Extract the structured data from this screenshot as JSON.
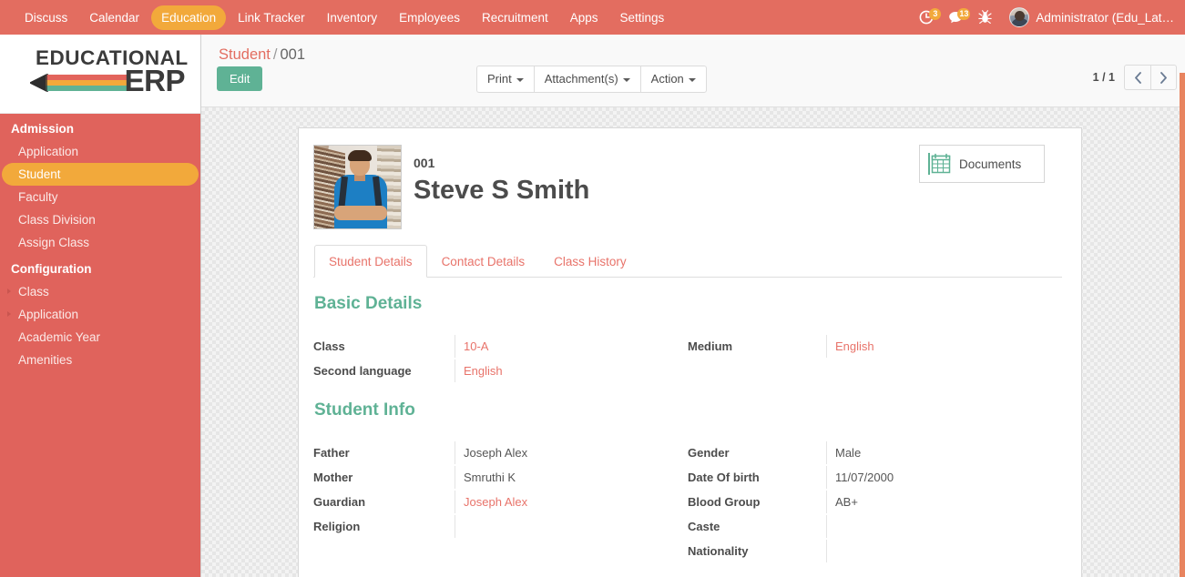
{
  "navbar": {
    "menu_items": [
      {
        "label": "Discuss",
        "active": false
      },
      {
        "label": "Calendar",
        "active": false
      },
      {
        "label": "Education",
        "active": true
      },
      {
        "label": "Link Tracker",
        "active": false
      },
      {
        "label": "Inventory",
        "active": false
      },
      {
        "label": "Employees",
        "active": false
      },
      {
        "label": "Recruitment",
        "active": false
      },
      {
        "label": "Apps",
        "active": false
      },
      {
        "label": "Settings",
        "active": false
      }
    ],
    "activity_icon": "clock-icon",
    "activity_count": "3",
    "messages_icon": "chat-bubble-icon",
    "messages_count": "13",
    "debug_icon": "bug-icon",
    "avatar_icon": "user-avatar",
    "user_label": "Administrator (Edu_Lat…",
    "bg_color": "#E36D60",
    "active_pill_color": "#F2A93B"
  },
  "sidebar": {
    "logo": {
      "line1": "EDUCATIONAL",
      "line2": "ERP",
      "pencil_colors": [
        "#E3645C",
        "#F2A93B",
        "#5FB295"
      ]
    },
    "sections": [
      {
        "title": "Admission",
        "items": [
          {
            "label": "Application",
            "active": false,
            "caret": false
          },
          {
            "label": "Student",
            "active": true,
            "caret": false
          },
          {
            "label": "Faculty",
            "active": false,
            "caret": false
          },
          {
            "label": "Class Division",
            "active": false,
            "caret": false
          },
          {
            "label": "Assign Class",
            "active": false,
            "caret": false
          }
        ]
      },
      {
        "title": "Configuration",
        "items": [
          {
            "label": "Class",
            "active": false,
            "caret": true
          },
          {
            "label": "Application",
            "active": false,
            "caret": true
          },
          {
            "label": "Academic Year",
            "active": false,
            "caret": false
          },
          {
            "label": "Amenities",
            "active": false,
            "caret": false
          }
        ]
      }
    ],
    "bg_color": "#E0635C"
  },
  "control_panel": {
    "breadcrumb_root": "Student",
    "breadcrumb_sep": "/",
    "breadcrumb_current": "001",
    "edit_label": "Edit",
    "buttons": [
      {
        "label": "Print",
        "dropdown": true
      },
      {
        "label": "Attachment(s)",
        "dropdown": true
      },
      {
        "label": "Action",
        "dropdown": true
      }
    ],
    "pager_text": "1 / 1",
    "prev_icon": "chevron-left-icon",
    "next_icon": "chevron-right-icon",
    "edit_color": "#5FB295"
  },
  "record": {
    "id": "001",
    "name": "Steve S Smith",
    "photo_alt": "student-photo",
    "stat_button": {
      "icon": "calendar-grid-icon",
      "label": "Documents"
    }
  },
  "tabs": [
    {
      "label": "Student Details",
      "active": true
    },
    {
      "label": "Contact Details",
      "active": false
    },
    {
      "label": "Class History",
      "active": false
    }
  ],
  "basic_details": {
    "title": "Basic Details",
    "left": [
      {
        "label": "Class",
        "value": "10-A",
        "is_link": true
      },
      {
        "label": "Second language",
        "value": "English",
        "is_link": true
      }
    ],
    "right": [
      {
        "label": "Medium",
        "value": "English",
        "is_link": true
      }
    ]
  },
  "student_info": {
    "title": "Student Info",
    "left": [
      {
        "label": "Father",
        "value": "Joseph Alex",
        "is_link": false
      },
      {
        "label": "Mother",
        "value": "Smruthi K",
        "is_link": false
      },
      {
        "label": "Guardian",
        "value": "Joseph Alex",
        "is_link": true
      },
      {
        "label": "Religion",
        "value": "",
        "is_link": false
      }
    ],
    "right": [
      {
        "label": "Gender",
        "value": "Male",
        "is_link": false
      },
      {
        "label": "Date Of birth",
        "value": "11/07/2000",
        "is_link": false
      },
      {
        "label": "Blood Group",
        "value": "AB+",
        "is_link": false
      },
      {
        "label": "Caste",
        "value": "",
        "is_link": false
      },
      {
        "label": "Nationality",
        "value": "",
        "is_link": false
      }
    ]
  },
  "theme": {
    "accent_red": "#E36D60",
    "accent_orange": "#F2A93B",
    "accent_green": "#5FB295",
    "link_red": "#E8736A",
    "scrollbar": "#E8845F"
  }
}
